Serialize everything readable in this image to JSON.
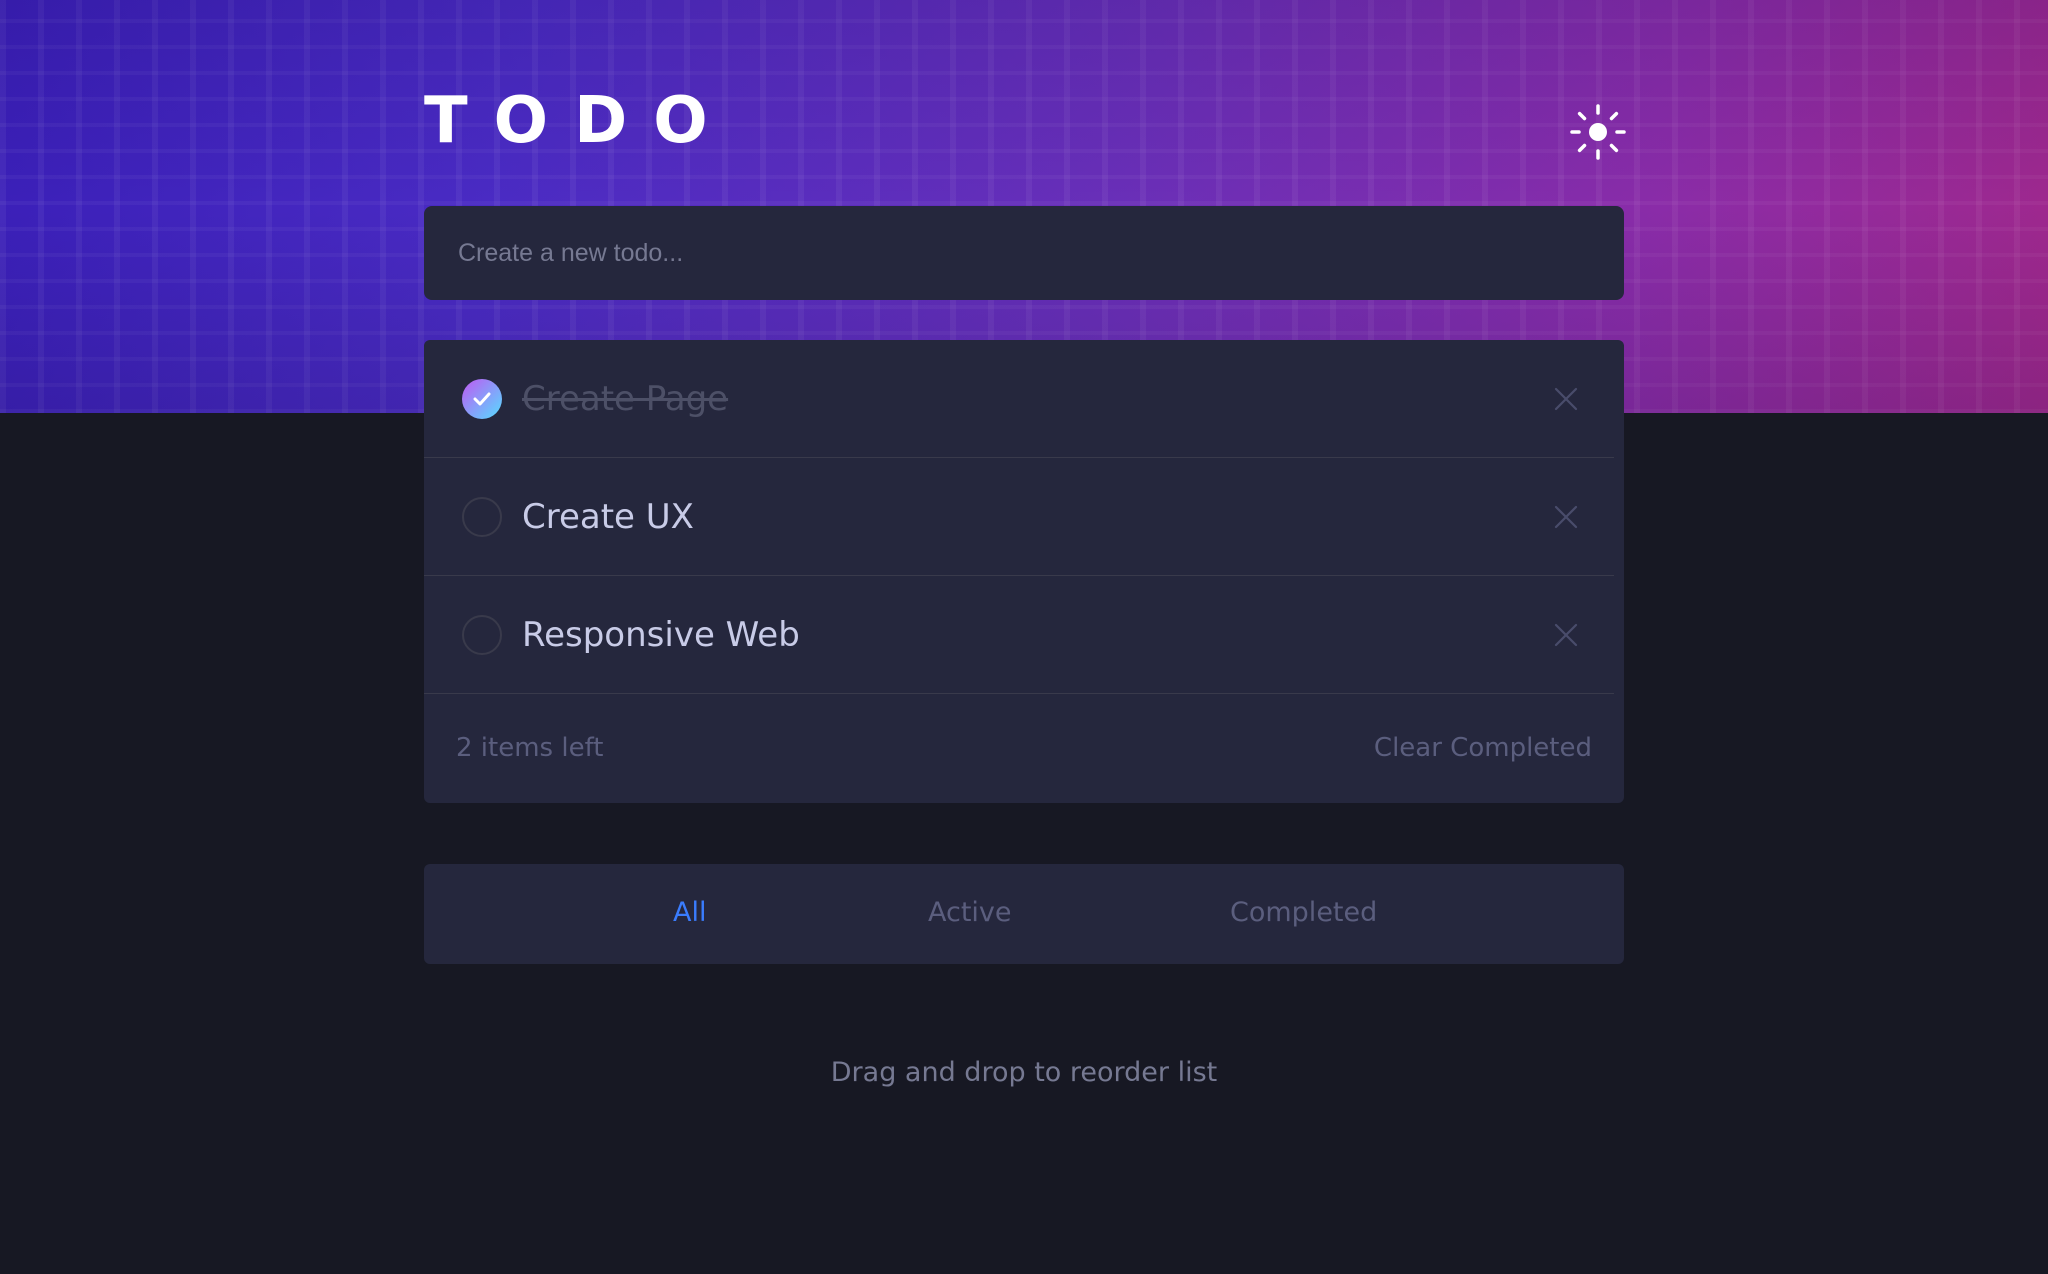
{
  "app": {
    "title": "TODO",
    "theme_toggle_icon": "sun-icon"
  },
  "new_todo": {
    "placeholder": "Create a new todo...",
    "value": ""
  },
  "todos": [
    {
      "text": "Create Page",
      "completed": true
    },
    {
      "text": "Create UX",
      "completed": false
    },
    {
      "text": "Responsive Web",
      "completed": false
    }
  ],
  "footer": {
    "items_left": "2 items left",
    "clear_label": "Clear Completed"
  },
  "filters": {
    "all": "All",
    "active": "Active",
    "completed": "Completed",
    "selected": "All"
  },
  "hint": "Drag and drop to reorder list",
  "colors": {
    "background": "#171823",
    "panel": "#25273d",
    "accent": "#3a7cfd",
    "check_gradient_start": "#c058f3",
    "check_gradient_end": "#55ddff"
  }
}
